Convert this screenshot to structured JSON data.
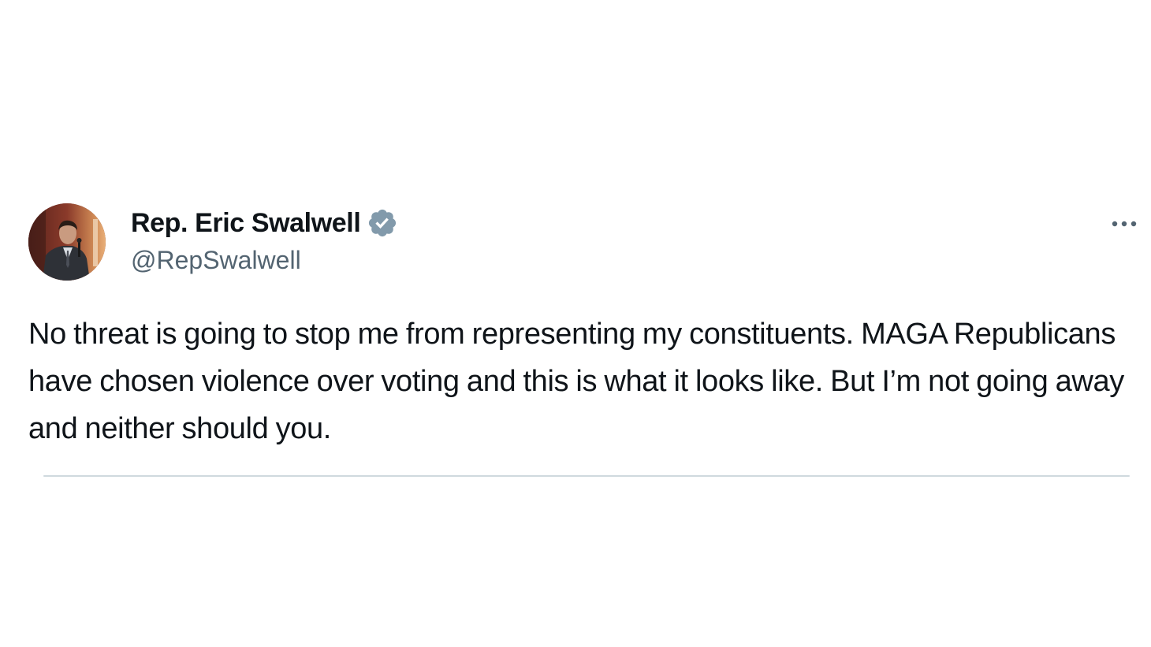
{
  "tweet": {
    "author": {
      "display_name": "Rep. Eric Swalwell",
      "handle": "@RepSwalwell",
      "verified": true,
      "verified_icon": "verified-badge-icon",
      "verified_color": "#829aab",
      "avatar_icon": "profile-photo"
    },
    "text": "No threat is going to stop me from representing my constituents. MAGA Republicans have chosen violence over voting and this is what it looks like. But I’m not going away and neither should you.",
    "more_icon": "more-options-icon"
  },
  "colors": {
    "text_primary": "#0f1419",
    "text_secondary": "#536471",
    "divider": "#cfd9de",
    "background": "#ffffff"
  }
}
